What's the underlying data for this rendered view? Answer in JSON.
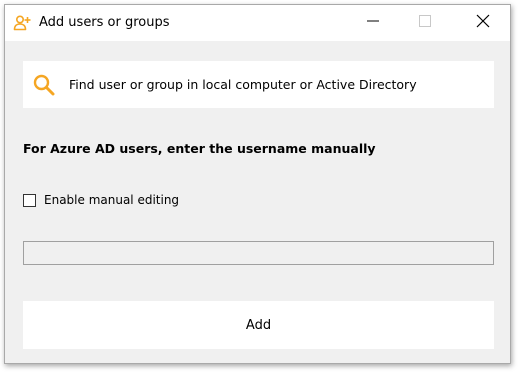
{
  "window": {
    "title": "Add users or groups",
    "title_icon": "add-user-icon",
    "controls": {
      "minimize": "minimize-icon",
      "maximize": "maximize-icon",
      "close": "close-icon"
    }
  },
  "search": {
    "icon": "search-icon",
    "label": "Find user or group in local computer or Active Directory"
  },
  "azure": {
    "heading": "For Azure AD users, enter the username manually"
  },
  "manual_editing": {
    "label": "Enable manual editing",
    "checked": false,
    "value": ""
  },
  "actions": {
    "add_label": "Add"
  },
  "colors": {
    "accent": "#f5a623",
    "window_bg": "#f0f0f0",
    "panel_bg": "#ffffff"
  }
}
